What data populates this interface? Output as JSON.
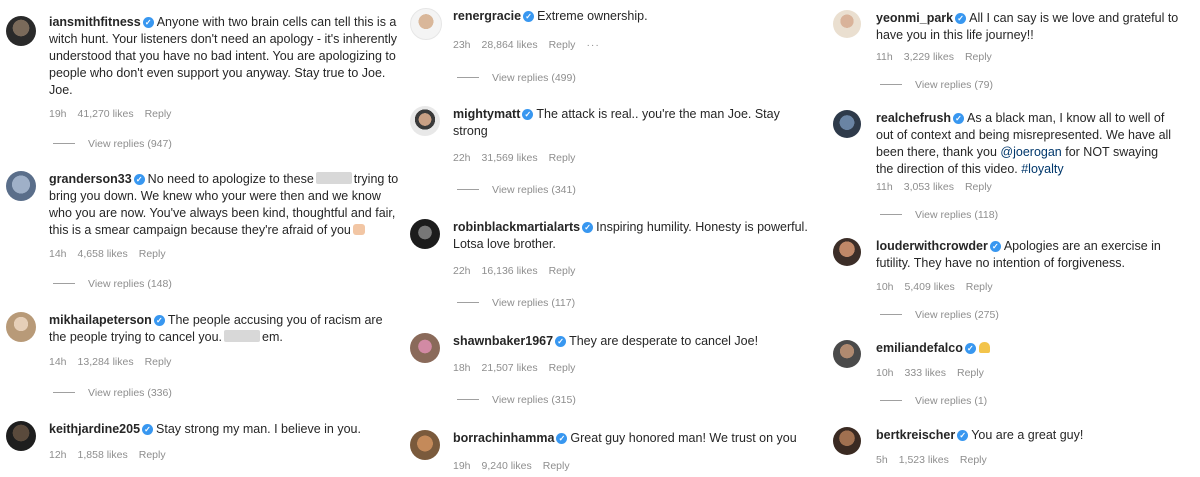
{
  "columns": [
    [
      {
        "user": "iansmithfitness",
        "pre": "Anyone with two brain cells can tell this is a witch hunt. Your listeners don't need an apology - it's inherently understood that you have no bad intent. You are apologizing to people who don't even support you anyway. Stay true to Joe. Joe.",
        "time": "19h",
        "likes": "41,270 likes",
        "reply": "Reply",
        "view_replies": "View replies (947)"
      },
      {
        "user": "granderson33",
        "pre": "No need to apologize to these",
        "post": "trying to bring you down. We knew who your were then and we know who you are now. You've always been kind, thoughtful and fair, this is a smear campaign because they're afraid of you",
        "time": "14h",
        "likes": "4,658 likes",
        "reply": "Reply",
        "view_replies": "View replies (148)"
      },
      {
        "user": "mikhailapeterson",
        "pre": "The people accusing you of racism are the people trying to cancel you.",
        "post": "em.",
        "time": "14h",
        "likes": "13,284 likes",
        "reply": "Reply",
        "view_replies": "View replies (336)"
      },
      {
        "user": "keithjardine205",
        "pre": "Stay strong my man. I believe in you.",
        "time": "12h",
        "likes": "1,858 likes",
        "reply": "Reply"
      }
    ],
    [
      {
        "user": "renergracie",
        "pre": "Extreme ownership.",
        "time": "23h",
        "likes": "28,864 likes",
        "reply": "Reply",
        "more": "···",
        "view_replies": "View replies (499)"
      },
      {
        "user": "mightymatt",
        "pre": "The attack is real.. you're the man Joe. Stay strong",
        "time": "22h",
        "likes": "31,569 likes",
        "reply": "Reply",
        "view_replies": "View replies (341)"
      },
      {
        "user": "robinblackmartialarts",
        "pre": "Inspiring humility. Honesty is powerful. Lotsa love brother.",
        "time": "22h",
        "likes": "16,136 likes",
        "reply": "Reply",
        "view_replies": "View replies (117)"
      },
      {
        "user": "shawnbaker1967",
        "pre": "They are desperate to cancel Joe!",
        "time": "18h",
        "likes": "21,507 likes",
        "reply": "Reply",
        "view_replies": "View replies (315)"
      },
      {
        "user": "borrachinhamma",
        "pre": "Great guy honored man! We trust on you",
        "time": "19h",
        "likes": "9,240 likes",
        "reply": "Reply"
      }
    ],
    [
      {
        "user": "yeonmi_park",
        "pre": "All I can say is we love and grateful to have you in this life journey!!",
        "time": "11h",
        "likes": "3,229 likes",
        "reply": "Reply",
        "view_replies": "View replies (79)"
      },
      {
        "user": "realchefrush",
        "pre": "As a black man, I know all to well of out of context and being misrepresented. We have all been there, thank you",
        "mention": "@joerogan",
        "post": "for NOT swaying the direction of this video.",
        "hashtag": "#loyalty",
        "time": "11h",
        "likes": "3,053 likes",
        "reply": "Reply",
        "view_replies": "View replies (118)"
      },
      {
        "user": "louderwithcrowder",
        "pre": "Apologies are an exercise in futility. They have no intention of forgiveness.",
        "time": "10h",
        "likes": "5,409 likes",
        "reply": "Reply",
        "view_replies": "View replies (275)"
      },
      {
        "user": "emiliandefalco",
        "pre": "",
        "time": "10h",
        "likes": "333 likes",
        "reply": "Reply",
        "view_replies": "View replies (1)"
      },
      {
        "user": "bertkreischer",
        "pre": "You are a great guy!",
        "time": "5h",
        "likes": "1,523 likes",
        "reply": "Reply"
      }
    ]
  ],
  "icons": {
    "verified": "verified-badge-icon",
    "avatar": "avatar"
  },
  "colors": {
    "username": "#262626",
    "meta": "#8e8e8e",
    "verified": "#3897f0",
    "mention": "#00376b"
  }
}
